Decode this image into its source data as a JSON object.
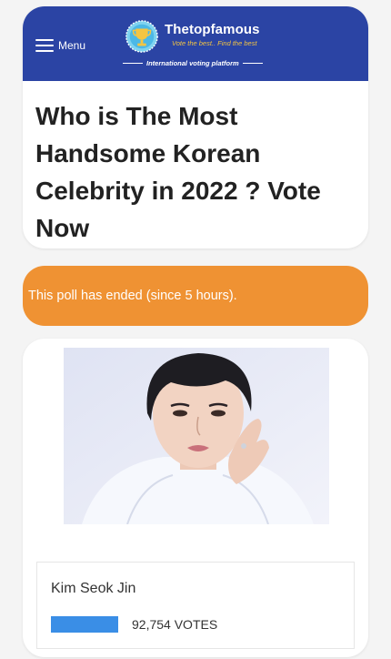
{
  "header": {
    "menu_label": "Menu",
    "brand_name": "Thetopfamous",
    "tagline": "Vote the best.. Find the best",
    "subtitle": "International voting platform",
    "logo_icon": "trophy-icon"
  },
  "poll": {
    "title": "Who is The Most Handsome Korean Celebrity in 2022 ? Vote Now",
    "status": "This poll has ended (since 5 hours)."
  },
  "candidate": {
    "name": "Kim Seok Jin",
    "votes_label": "92,754 VOTES",
    "vote_bar_fraction": 1.0
  },
  "colors": {
    "header_blue": "#2b44a4",
    "status_orange": "#ef9233",
    "bar_blue": "#3a8ee6",
    "tagline_gold": "#f4c542"
  }
}
